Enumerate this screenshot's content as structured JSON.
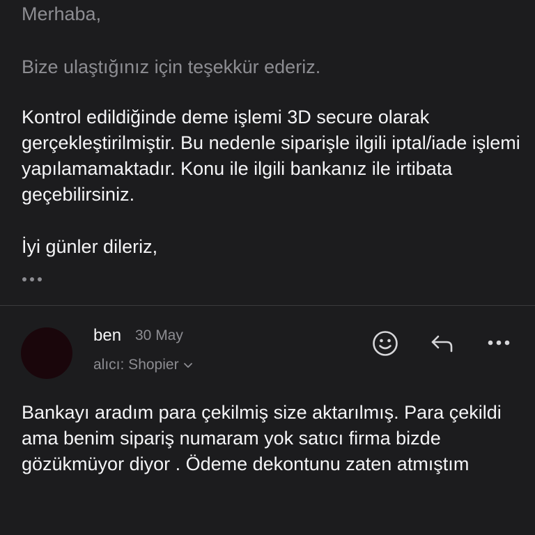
{
  "previous_message": {
    "greeting": "Merhaba,",
    "thanks": "Bize ulaştığınız için teşekkür ederiz.",
    "body": "Kontrol edildiğinde deme işlemi 3D secure olarak gerçekleştirilmiştir. Bu nedenle siparişle ilgili iptal/iade işlemi yapılamamaktadır. Konu ile ilgili bankanız ile irtibata geçebilirsiniz.",
    "closing": "İyi günler dileriz,",
    "more_icon": "ellipsis-icon"
  },
  "reply": {
    "sender": "ben",
    "date": "30 May",
    "recipient": "alıcı: Shopier",
    "recipient_icon": "chevron-down-icon",
    "actions": {
      "emoji_icon": "smiley-face-icon",
      "reply_icon": "reply-arrow-icon",
      "more_icon": "more-horizontal-icon"
    },
    "body": "Bankayı aradım para çekilmiş size aktarılmış. Para çekildi ama benim sipariş numaram yok satıcı firma bizde gözükmüyor diyor . Ödeme dekontunu zaten atmıştım"
  },
  "colors": {
    "background": "#1c1c1e",
    "text_primary": "#f5f5f7",
    "text_secondary": "#8d8d92",
    "divider": "#3a3a3c"
  }
}
